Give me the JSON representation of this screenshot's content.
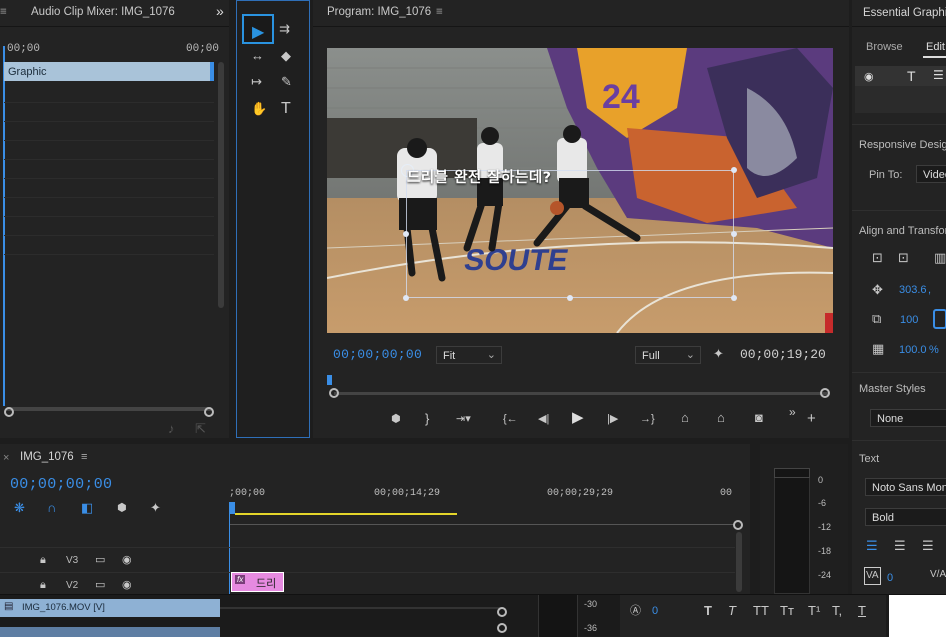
{
  "audio_mixer": {
    "title": "Audio Clip Mixer: IMG_1076",
    "menu_glyph": "≡",
    "more_glyph": "»",
    "tc_left": "00;00",
    "tc_right": "00;00",
    "track_label": "Graphic"
  },
  "tools": {
    "selection": "▶",
    "track_select": "⇉",
    "ripple": "↔",
    "razor": "◆",
    "slip": "↦",
    "pen": "✎",
    "hand": "✋",
    "type": "T"
  },
  "program": {
    "title": "Program: IMG_1076",
    "menu_glyph": "≡",
    "caption": "드리블 완전 잘하는데?",
    "current_tc": "00;00;00;00",
    "fit_label": "Fit",
    "full_label": "Full",
    "duration_tc": "00;00;19;20",
    "wrench": "🔧",
    "transport": [
      "▼",
      "}",
      "→▼",
      "{→",
      "◀|",
      "▶",
      "|▶",
      "→}",
      "⏏",
      "⏏",
      "◉",
      "»",
      "+"
    ]
  },
  "essential_graphics": {
    "title": "Essential Graphic",
    "tabs": [
      "Browse",
      "Edit"
    ],
    "responsive_label": "Responsive Desig",
    "pin_to_label": "Pin To:",
    "pin_to_value": "Video",
    "align_label": "Align and Transfor",
    "position_value": "303.6",
    "position_sep": ",",
    "scale_value": "100",
    "opacity_value": "100.0",
    "opacity_unit": "%",
    "master_styles_label": "Master Styles",
    "master_styles_value": "None",
    "text_label": "Text",
    "font_value": "Noto Sans Mon",
    "style_value": "Bold",
    "tracking_value": "0",
    "kerning_value": "0",
    "text_style_buttons": [
      "T",
      "T",
      "TT",
      "Tт",
      "T¹",
      "T,",
      "T"
    ]
  },
  "timeline": {
    "title": "IMG_1076",
    "close_glyph": "×",
    "menu_glyph": "≡",
    "current_tc": "00;00;00;00",
    "ruler": [
      ";00;00",
      "00;00;14;29",
      "00;00;29;29",
      "00"
    ],
    "tracks": [
      {
        "name": "V3"
      },
      {
        "name": "V2"
      }
    ],
    "clip_label": "드리",
    "clip_fx": "fx",
    "source_label": "IMG_1076.MOV [V]"
  },
  "meter": {
    "scale": [
      "0",
      "-6",
      "-12",
      "-18",
      "-24",
      "-30",
      "-36"
    ]
  }
}
